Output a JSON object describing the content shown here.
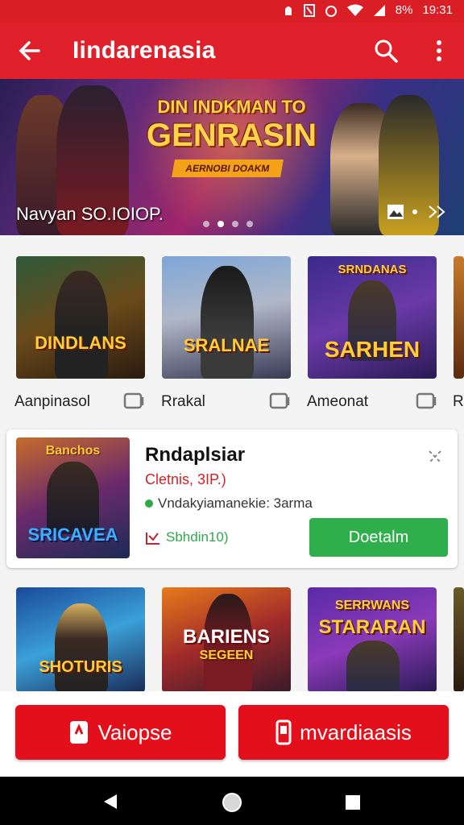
{
  "status_bar": {
    "battery": "8%",
    "time": "19:31"
  },
  "app_bar": {
    "title": "Iindarenasia"
  },
  "hero": {
    "headline_line1": "DIN INDKMAN TO",
    "headline_line2": "GENRASIN",
    "ribbon": "AERNOBI DOAKM",
    "caption": "Navyan SO.IOIOP.",
    "dots": 4,
    "active_dot": 1
  },
  "featured_row": [
    {
      "art_title": "DINDLANS",
      "label": "Aanpinasol"
    },
    {
      "art_title": "SRALNAE",
      "label": "Rrakal"
    },
    {
      "art_title": "SARHEN",
      "art_subtitle": "SRNDANAS",
      "label": "Ameonat"
    },
    {
      "label": "R"
    }
  ],
  "game_card": {
    "name": "Rndaplsiar",
    "subtitle": "Cletnis, 3IP.)",
    "status": "Vndakyiamanekie: 3arma",
    "rating": "Sbhdin10)",
    "button": "Doetalm",
    "art_title": "SRICAVEA",
    "art_top": "Banchos"
  },
  "second_row": [
    {
      "art_title": "SHOTURIS"
    },
    {
      "art_title": "BARIENS",
      "art_sub": "SEGEEN"
    },
    {
      "art_title": "STARARAN",
      "art_sub": "SERRWANS"
    }
  ],
  "bottom_buttons": {
    "left": "Vaiopse",
    "right": "mvardiaasis"
  },
  "colors": {
    "primary": "#e0202a",
    "status_bar": "#d91e26",
    "accent_green": "#2fae4c",
    "bottom_button": "#e3101c"
  }
}
